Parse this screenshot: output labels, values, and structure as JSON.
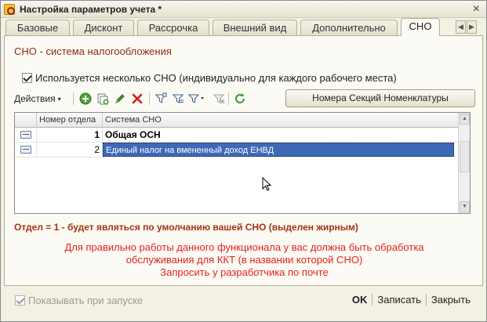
{
  "window": {
    "title": "Настройка параметров учета *",
    "close_glyph": "×"
  },
  "tabs": [
    {
      "label": "Базовые"
    },
    {
      "label": "Дисконт"
    },
    {
      "label": "Рассрочка"
    },
    {
      "label": "Внешний вид"
    },
    {
      "label": "Дополнительно"
    },
    {
      "label": "СНО",
      "active": true
    }
  ],
  "tab_scroll": {
    "left": "◀",
    "right": "▶"
  },
  "section": {
    "title": "СНО - система налогообложения",
    "multi_checkbox": {
      "label": "Используется несколько СНО (индивидуально для каждого рабочего места)",
      "checked": true
    }
  },
  "toolbar": {
    "actions_label": "Действия",
    "actions_arrow": "▾",
    "icons": [
      "add-icon",
      "copy-icon",
      "edit-icon",
      "delete-icon",
      "filter-icon",
      "filter-list-icon",
      "filter-dropdown-icon",
      "clear-filter-icon",
      "refresh-icon"
    ],
    "nomenclature_button": "Номера Секций Номенклатуры"
  },
  "table": {
    "columns": [
      "Номер отдела",
      "Система СНО"
    ],
    "rows": [
      {
        "number": "1",
        "system": "Общая ОСН",
        "bold": true,
        "selected": false
      },
      {
        "number": "2",
        "system": "Единый налог на вмененный доход ЕНВД",
        "bold": false,
        "selected": true
      }
    ],
    "scroll_up": "▲",
    "scroll_down": "▼"
  },
  "note_default": "Отдел = 1 - будет являться по умолчанию вашей СНО (выделен жирным)",
  "warning_lines": [
    "Для правильно работы данного функционала у вас должна быть обработка",
    "обслуживания  для ККТ (в названии которой СНО)",
    "Запросить у разработчика по почте"
  ],
  "footer": {
    "show_on_start": {
      "label": "Показывать при запуске",
      "checked": true,
      "disabled": true
    },
    "ok": "OK",
    "save": "Записать",
    "close": "Закрыть"
  },
  "colors": {
    "accent_title": "#8c2c12",
    "warning": "#e4231c",
    "selection": "#3d69b7"
  }
}
